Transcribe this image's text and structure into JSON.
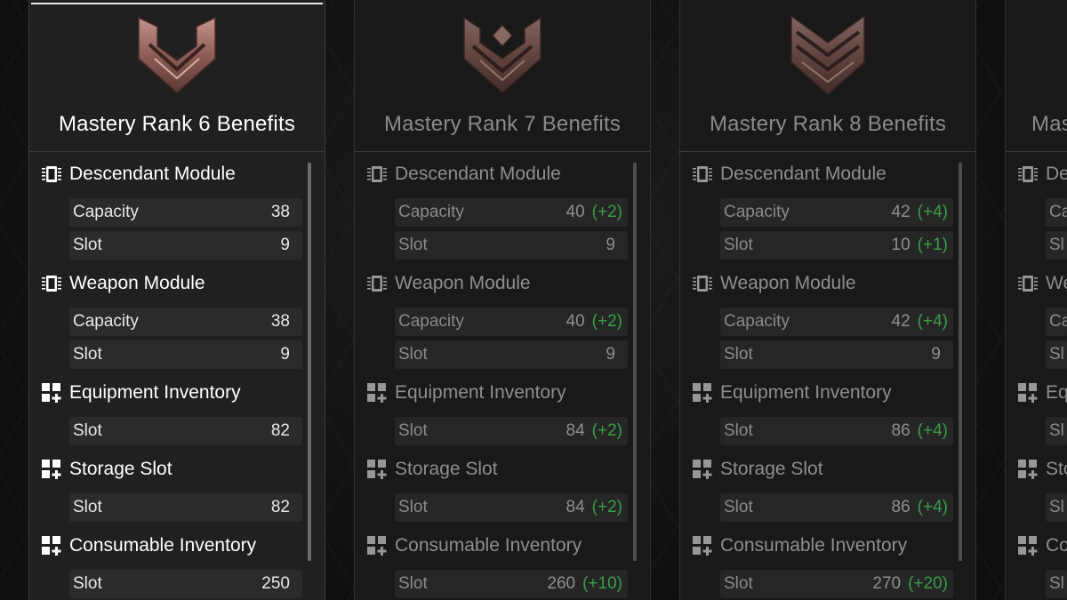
{
  "colors": {
    "accent_green": "#3fb34f",
    "emblem_copper": "#9a6a62"
  },
  "cards": [
    {
      "title": "Mastery Rank 6 Benefits",
      "descendant_module": {
        "label": "Descendant Module",
        "capacity_label": "Capacity",
        "capacity": "38",
        "capacity_delta": "",
        "slot_label": "Slot",
        "slot": "9",
        "slot_delta": ""
      },
      "weapon_module": {
        "label": "Weapon Module",
        "capacity_label": "Capacity",
        "capacity": "38",
        "capacity_delta": "",
        "slot_label": "Slot",
        "slot": "9",
        "slot_delta": ""
      },
      "equipment_inventory": {
        "label": "Equipment Inventory",
        "slot_label": "Slot",
        "slot": "82",
        "slot_delta": ""
      },
      "storage_slot": {
        "label": "Storage Slot",
        "slot_label": "Slot",
        "slot": "82",
        "slot_delta": ""
      },
      "consumable_inventory": {
        "label": "Consumable Inventory",
        "slot_label": "Slot",
        "slot": "250",
        "slot_delta": ""
      }
    },
    {
      "title": "Mastery Rank 7 Benefits",
      "descendant_module": {
        "label": "Descendant Module",
        "capacity_label": "Capacity",
        "capacity": "40",
        "capacity_delta": "(+2)",
        "slot_label": "Slot",
        "slot": "9",
        "slot_delta": ""
      },
      "weapon_module": {
        "label": "Weapon Module",
        "capacity_label": "Capacity",
        "capacity": "40",
        "capacity_delta": "(+2)",
        "slot_label": "Slot",
        "slot": "9",
        "slot_delta": ""
      },
      "equipment_inventory": {
        "label": "Equipment Inventory",
        "slot_label": "Slot",
        "slot": "84",
        "slot_delta": "(+2)"
      },
      "storage_slot": {
        "label": "Storage Slot",
        "slot_label": "Slot",
        "slot": "84",
        "slot_delta": "(+2)"
      },
      "consumable_inventory": {
        "label": "Consumable Inventory",
        "slot_label": "Slot",
        "slot": "260",
        "slot_delta": "(+10)"
      }
    },
    {
      "title": "Mastery Rank 8 Benefits",
      "descendant_module": {
        "label": "Descendant Module",
        "capacity_label": "Capacity",
        "capacity": "42",
        "capacity_delta": "(+4)",
        "slot_label": "Slot",
        "slot": "10",
        "slot_delta": "(+1)"
      },
      "weapon_module": {
        "label": "Weapon Module",
        "capacity_label": "Capacity",
        "capacity": "42",
        "capacity_delta": "(+4)",
        "slot_label": "Slot",
        "slot": "9",
        "slot_delta": ""
      },
      "equipment_inventory": {
        "label": "Equipment Inventory",
        "slot_label": "Slot",
        "slot": "86",
        "slot_delta": "(+4)"
      },
      "storage_slot": {
        "label": "Storage Slot",
        "slot_label": "Slot",
        "slot": "86",
        "slot_delta": "(+4)"
      },
      "consumable_inventory": {
        "label": "Consumable Inventory",
        "slot_label": "Slot",
        "slot": "270",
        "slot_delta": "(+20)"
      }
    },
    {
      "title": "Mas",
      "descendant_module": {
        "label": "De",
        "capacity_label": "Ca",
        "slot_label": "Sl"
      },
      "weapon_module": {
        "label": "We",
        "capacity_label": "Ca",
        "slot_label": "Sl"
      },
      "equipment_inventory": {
        "label": "Eq",
        "slot_label": "Sl"
      },
      "storage_slot": {
        "label": "Sto",
        "slot_label": "Sl"
      },
      "consumable_inventory": {
        "label": "Co",
        "slot_label": "Sl"
      }
    }
  ]
}
